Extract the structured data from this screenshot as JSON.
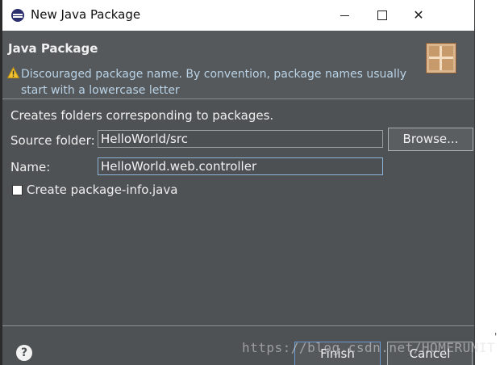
{
  "window": {
    "title": "New Java Package"
  },
  "header": {
    "title": "Java Package",
    "warning": "Discouraged package name. By convention, package names usually start with a lowercase letter"
  },
  "body": {
    "description": "Creates folders corresponding to packages.",
    "source_folder_label": "Source folder:",
    "source_folder_value": "HelloWorld/src",
    "browse_label": "Browse...",
    "name_label": "Name:",
    "name_value": "HelloWorld.web.controller",
    "create_info_label": "Create package-info.java",
    "create_info_checked": false
  },
  "footer": {
    "help": "?",
    "finish_label": "Finish",
    "cancel_label": "Cancel"
  },
  "watermark": "https://blog.csdn.net/HOMERUNIT",
  "icons": [
    "java-package-icon",
    "minimize-icon",
    "maximize-icon",
    "close-icon",
    "warning-icon",
    "package-banner-icon",
    "help-icon"
  ],
  "colors": {
    "dialog_bg": "#4e5254",
    "header_bg": "#55595b",
    "warning_text": "#b9d2e6",
    "focus": "#8fb4d9"
  }
}
